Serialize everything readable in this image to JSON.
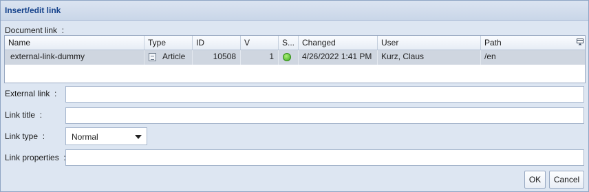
{
  "dialog": {
    "title": "Insert/edit link"
  },
  "document_link": {
    "label": "Document link",
    "colon": ":",
    "columns": [
      "Name",
      "Type",
      "ID",
      "V",
      "S...",
      "Changed",
      "User",
      "Path"
    ],
    "row": {
      "name": "external-link-dummy",
      "type": "Article",
      "id": "10508",
      "version": "1",
      "status_icon": "green-status-dot",
      "changed": "4/26/2022 1:41 PM",
      "user": "Kurz, Claus",
      "path": "/en"
    }
  },
  "external_link": {
    "label": "External link",
    "colon": ":",
    "value": ""
  },
  "link_title": {
    "label": "Link title",
    "colon": ":",
    "value": ""
  },
  "link_type": {
    "label": "Link type",
    "colon": ":",
    "selected": "Normal"
  },
  "link_properties": {
    "label": "Link properties",
    "colon": ":",
    "value": ""
  },
  "buttons": {
    "ok": "OK",
    "cancel": "Cancel"
  },
  "colors": {
    "title_text": "#15428b",
    "dialog_bg": "#dde6f2",
    "selected_row": "#cfd6e0"
  }
}
